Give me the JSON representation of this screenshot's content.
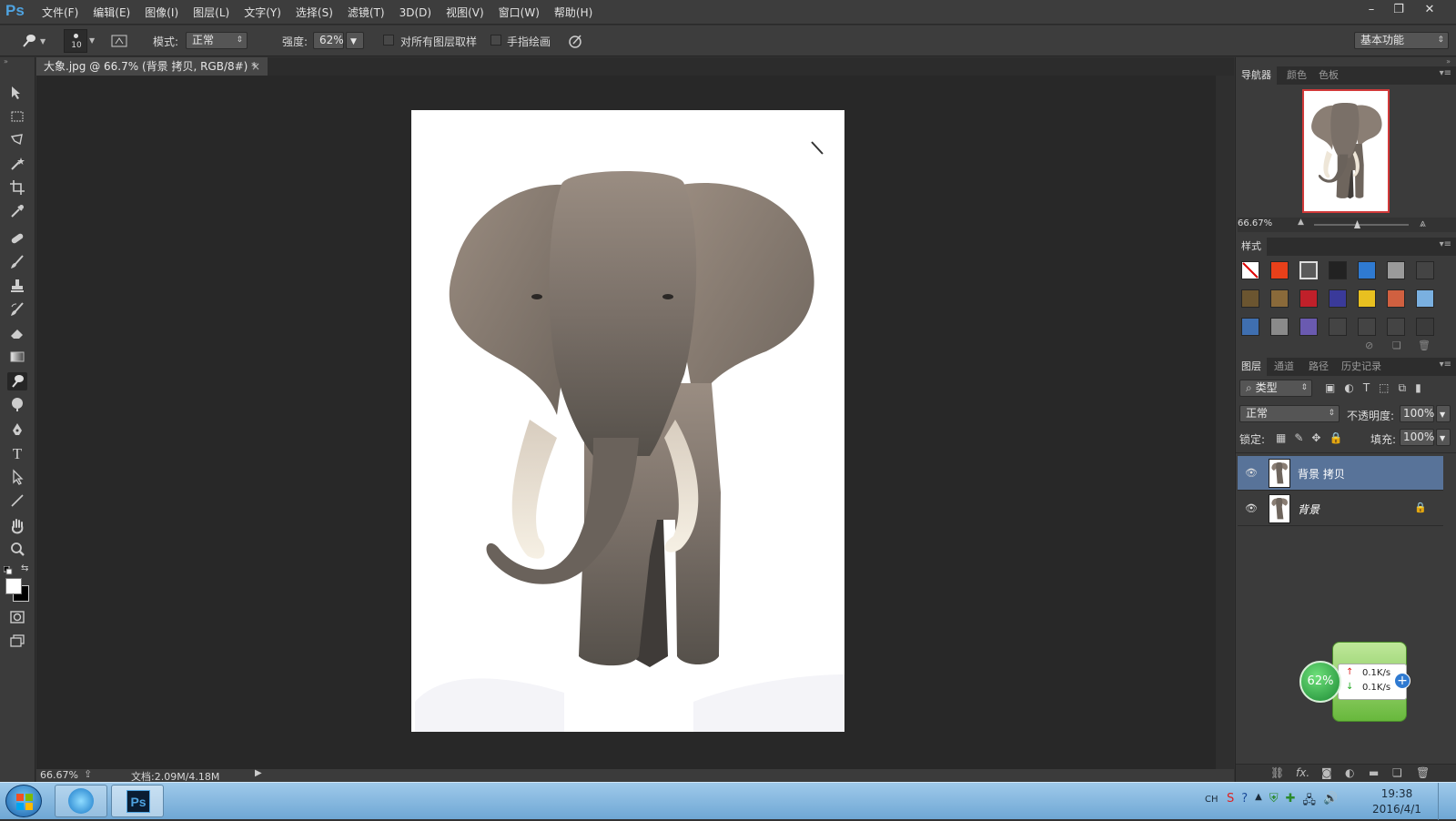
{
  "app": {
    "logo": "Ps",
    "menu": [
      "文件(F)",
      "编辑(E)",
      "图像(I)",
      "图层(L)",
      "文字(Y)",
      "选择(S)",
      "滤镜(T)",
      "3D(D)",
      "视图(V)",
      "窗口(W)",
      "帮助(H)"
    ],
    "window_controls": {
      "minimize": "–",
      "restore": "❐",
      "close": "✕"
    }
  },
  "options": {
    "brush_size": "10",
    "mode_label": "模式:",
    "mode_value": "正常",
    "strength_label": "强度:",
    "strength_value": "62%",
    "sample_all_layers": "对所有图层取样",
    "finger_painting": "手指绘画",
    "workspace": "基本功能"
  },
  "document": {
    "tab_title": "大象.jpg @ 66.7% (背景 拷贝, RGB/8#) *",
    "tab_close": "×"
  },
  "statusbar": {
    "zoom": "66.67%",
    "doc_info": "文档:2.09M/4.18M"
  },
  "navigator": {
    "tabs": [
      "导航器",
      "颜色",
      "色板"
    ],
    "zoom": "66.67%"
  },
  "styles": {
    "tab": "样式",
    "swatches": [
      "#ffffff",
      "#e8401a",
      "#5a5a5a",
      "#222222",
      "#2f7ad1",
      "#9a9a9a",
      "#444444",
      "#6b5530",
      "#8a6a3a",
      "#c0202a",
      "#3a3a9a",
      "#e8c020",
      "#d06040",
      "#7ab0e0",
      "#3f6fb0",
      "#8a8a8a",
      "#6a5ab0",
      "#444444",
      "#444444",
      "#444444",
      "#3b3b3b"
    ]
  },
  "layers": {
    "tabs": [
      "图层",
      "通道",
      "路径",
      "历史记录"
    ],
    "filter_kind": "类型",
    "blend_mode": "正常",
    "opacity_label": "不透明度:",
    "opacity_value": "100%",
    "lock_label": "锁定:",
    "fill_label": "填充:",
    "fill_value": "100%",
    "items": [
      {
        "name": "背景 拷贝",
        "selected": true,
        "locked": false
      },
      {
        "name": "背景",
        "selected": false,
        "locked": true
      }
    ],
    "footer_icons": [
      "link-icon",
      "fx-icon",
      "mask-icon",
      "adjustment-icon",
      "folder-icon",
      "new-layer-icon",
      "trash-icon"
    ]
  },
  "net_widget": {
    "percent": "62%",
    "up": "0.1K/s",
    "down": "0.1K/s"
  },
  "taskbar": {
    "lang": "CH",
    "time": "19:38",
    "date": "2016/4/1"
  },
  "colors": {
    "accent_selection": "#587399",
    "ps_blue": "#4fa3e0",
    "taskbar": "#8bbde3"
  }
}
